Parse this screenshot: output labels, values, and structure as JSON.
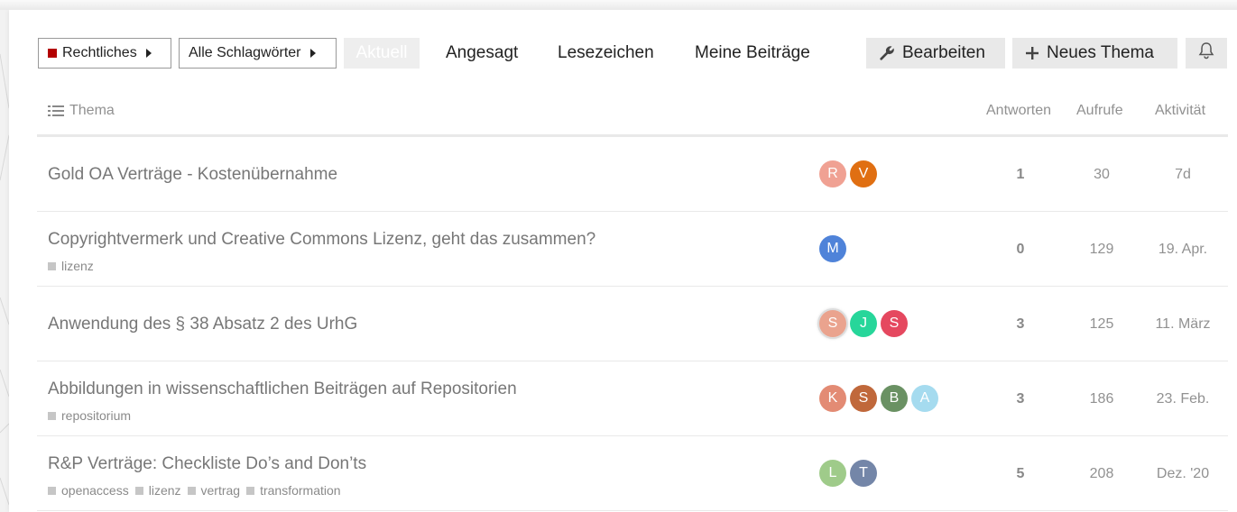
{
  "nav": {
    "category": {
      "label": "Rechtliches",
      "color": "#b30000"
    },
    "tags_dropdown": {
      "label": "Alle Schlagwörter"
    },
    "tabs": [
      {
        "label": "Aktuell",
        "active": true
      },
      {
        "label": "Angesagt"
      },
      {
        "label": "Lesezeichen"
      },
      {
        "label": "Meine Beiträge"
      }
    ],
    "edit_button": {
      "label": "Bearbeiten",
      "icon": "wrench-icon"
    },
    "new_topic_button": {
      "label": "Neues Thema",
      "icon": "plus-icon"
    },
    "notifications_button": {
      "icon": "bell-icon"
    }
  },
  "table": {
    "headers": {
      "topic": "Thema",
      "replies": "Antworten",
      "views": "Aufrufe",
      "activity": "Aktivität"
    },
    "rows": [
      {
        "title": "Gold OA Verträge - Kostenübernahme",
        "tags": [],
        "posters": [
          {
            "letter": "R",
            "color": "#f0a193"
          },
          {
            "letter": "V",
            "color": "#e06f12"
          }
        ],
        "replies": "1",
        "views": "30",
        "activity": "7d"
      },
      {
        "title": "Copyrightvermerk und Creative Commons Lizenz, geht das zusammen?",
        "tags": [
          "lizenz"
        ],
        "posters": [
          {
            "letter": "M",
            "color": "#4f83d9"
          }
        ],
        "replies": "0",
        "views": "129",
        "activity": "19. Apr."
      },
      {
        "title": "Anwendung des § 38 Absatz 2 des UrhG",
        "tags": [],
        "posters": [
          {
            "letter": "S",
            "color": "#eaa38e",
            "op": true
          },
          {
            "letter": "J",
            "color": "#27d69a"
          },
          {
            "letter": "S",
            "color": "#e5485f"
          }
        ],
        "replies": "3",
        "views": "125",
        "activity": "11. März"
      },
      {
        "title": "Abbildungen in wissenschaftlichen Beiträgen auf Repositorien",
        "tags": [
          "repositorium"
        ],
        "posters": [
          {
            "letter": "K",
            "color": "#e38b74"
          },
          {
            "letter": "S",
            "color": "#c0683b"
          },
          {
            "letter": "B",
            "color": "#6a9163"
          },
          {
            "letter": "A",
            "color": "#a5dbef"
          }
        ],
        "replies": "3",
        "views": "186",
        "activity": "23. Feb."
      },
      {
        "title": "R&P Verträge: Checkliste Do’s and Don’ts",
        "tags": [
          "openaccess",
          "lizenz",
          "vertrag",
          "transformation"
        ],
        "posters": [
          {
            "letter": "L",
            "color": "#9fcb8a"
          },
          {
            "letter": "T",
            "color": "#7486a8"
          }
        ],
        "replies": "5",
        "views": "208",
        "activity": "Dez. '20"
      }
    ]
  }
}
